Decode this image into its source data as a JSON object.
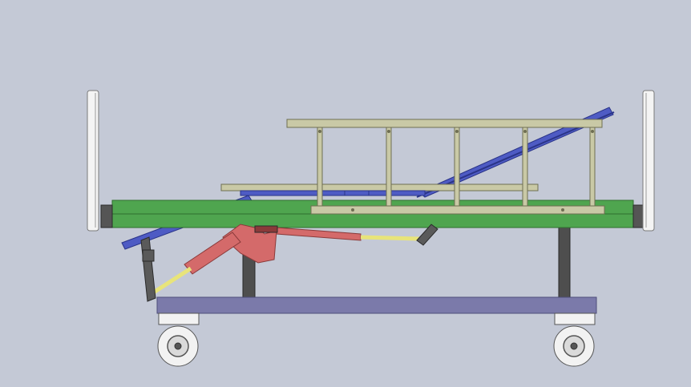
{
  "scene": {
    "subject": "hospital-bed-side-elevation",
    "colors": {
      "background": "#C4C9D6",
      "frame_green": "#4FA54F",
      "frame_green_dark": "#2F6E2F",
      "deck_blue": "#4E5BC4",
      "deck_blue_dark": "#2A3488",
      "rail_khaki": "#C9C9A6",
      "rail_khaki_dark": "#6E6E52",
      "base_purple": "#7B7AAA",
      "base_purple_dark": "#4E4D7A",
      "leg_gray": "#4E4E4E",
      "actuator_red": "#D46A6A",
      "actuator_red_dark": "#8A3A3A",
      "rod_yellow": "#E8E47A",
      "headboard_white": "#F4F4F4",
      "caster_white": "#F2F2F2",
      "outline": "#2A2A2A"
    }
  }
}
